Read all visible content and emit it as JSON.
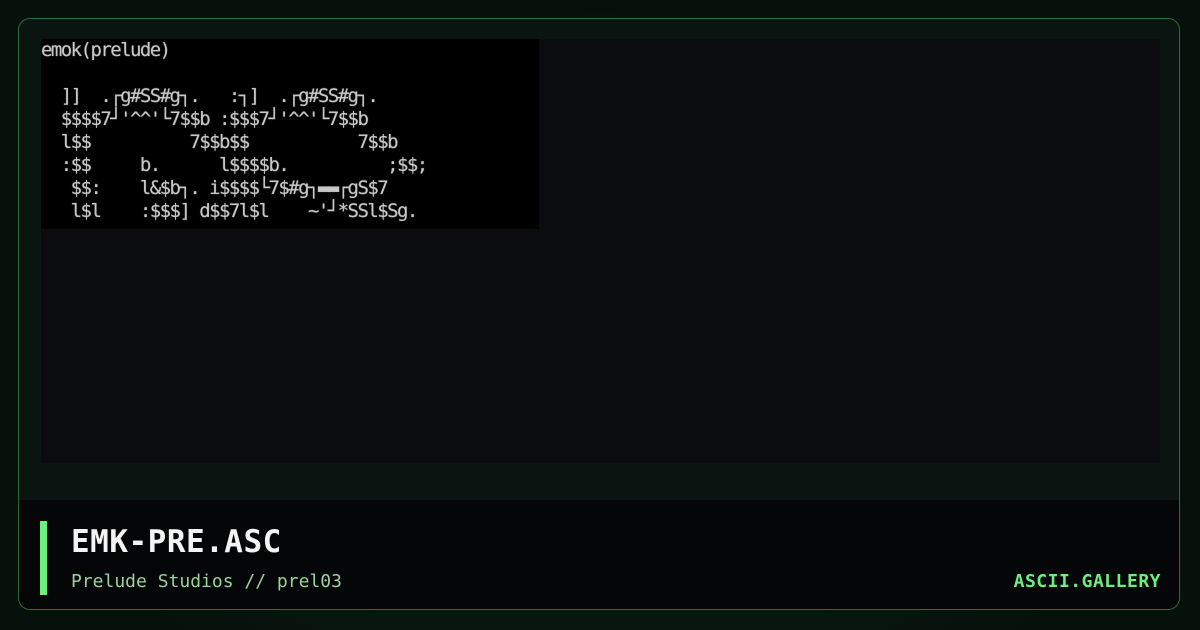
{
  "viewer": {
    "art_lines": [
      "emok(prelude)",
      "",
      "  ]]  .┌g#SS#g┐.   :┐]  .┌g#SS#g┐.",
      "  $$$$7┘'^^'└7$$b :$$$7┘'^^'└7$$b",
      "  l$$          7$$b$$           7$$b",
      "  :$$     b.      l$$$$b.          ;$$;",
      "   $$:    l&$b┐. i$$$$└7$#g┐▬▬┌gS$7",
      "   l$l    :$$$] d$$7l$l    ~'┘*SSl$Sg."
    ]
  },
  "footer": {
    "title": "EMK-PRE.ASC",
    "subtitle": "Prelude Studios // prel03",
    "brand": "ASCII.GALLERY"
  },
  "colors": {
    "accent": "#6cf07d",
    "border": "#2f6b3d",
    "background": "#07110c"
  }
}
